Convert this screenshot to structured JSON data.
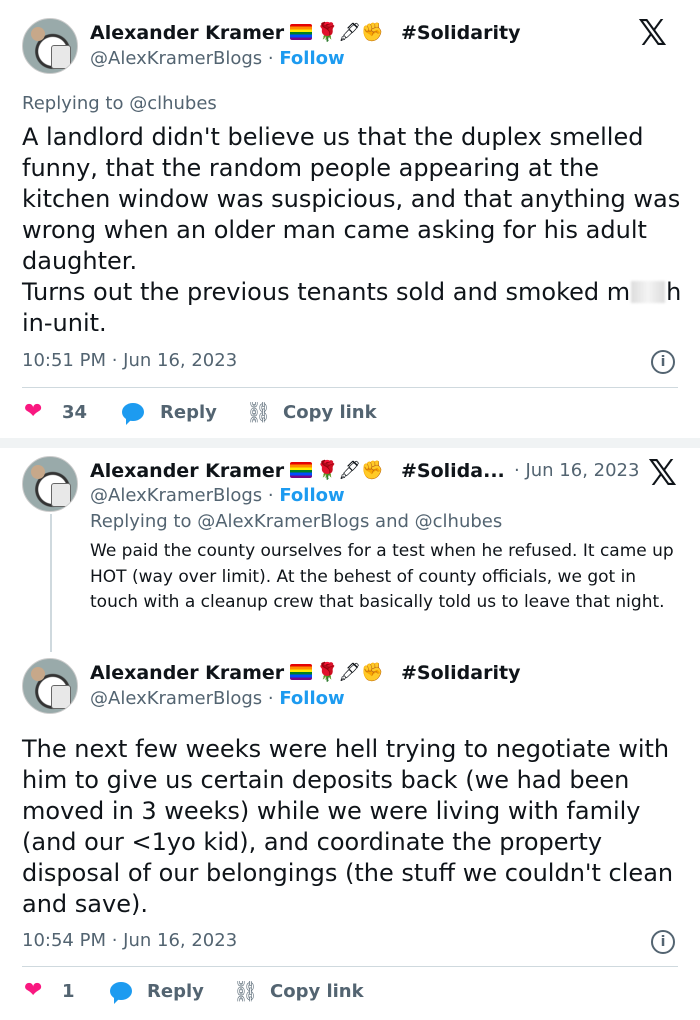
{
  "tweet1": {
    "name": "Alexander Kramer",
    "emoji_suffix": "🌹🖋✊",
    "tag": "#Solidarity",
    "handle": "@AlexKramerBlogs",
    "separator": "·",
    "follow": "Follow",
    "replying_to": "Replying to @clhubes",
    "text_before_blur": "A landlord didn't believe us that the duplex smelled funny, that the random people appearing at the kitchen window was suspicious, and that anything was wrong when an older man came asking for his adult daughter.\nTurns out the previous tenants sold and smoked m",
    "text_after_blur": "h in-unit.",
    "timestamp": "10:51 PM · Jun 16, 2023",
    "likes": "34",
    "reply_label": "Reply",
    "copy_link_label": "Copy link"
  },
  "tweet2": {
    "name": "Alexander Kramer",
    "emoji_suffix": "🌹🖋✊",
    "tag": "#Solida...",
    "date": "· Jun 16, 2023",
    "handle": "@AlexKramerBlogs",
    "separator": "·",
    "follow": "Follow",
    "replying_to": "Replying to @AlexKramerBlogs and @clhubes",
    "text": "We paid the county ourselves for a test when he refused. It came up HOT (way over limit). At the behest of county officials, we got in touch with a cleanup crew that basically told us to leave that night."
  },
  "tweet3": {
    "name": "Alexander Kramer",
    "emoji_suffix": "🌹🖋✊",
    "tag": "#Solidarity",
    "handle": "@AlexKramerBlogs",
    "separator": "·",
    "follow": "Follow",
    "text": "The next few weeks were hell trying to negotiate with him to give us certain deposits back (we had been moved in 3 weeks) while we were living with family (and our <1yo kid), and coordinate the property disposal of our belongings (the stuff we couldn't clean and save).",
    "timestamp": "10:54 PM · Jun 16, 2023",
    "likes": "1",
    "reply_label": "Reply",
    "copy_link_label": "Copy link"
  },
  "icons": {
    "x_logo": "𝕏",
    "info": "i",
    "heart": "❤",
    "link": "🔗"
  }
}
